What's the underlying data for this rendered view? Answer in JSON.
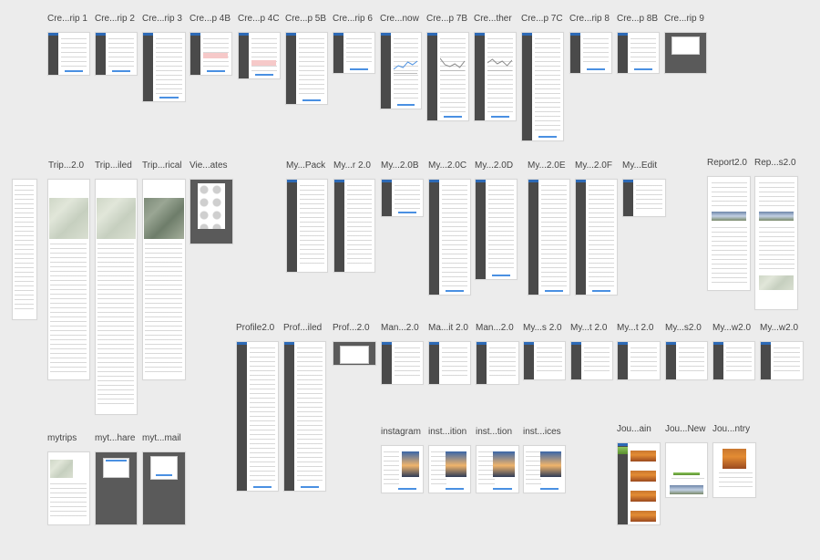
{
  "board": {
    "artboards": [
      {
        "id": "a1",
        "label": "Cre...rip 1"
      },
      {
        "id": "a2",
        "label": "Cre...rip 2"
      },
      {
        "id": "a3",
        "label": "Cre...rip 3"
      },
      {
        "id": "a4",
        "label": "Cre...p 4B"
      },
      {
        "id": "a5",
        "label": "Cre...p 4C"
      },
      {
        "id": "a6",
        "label": "Cre...p 5B"
      },
      {
        "id": "a7",
        "label": "Cre...rip 6"
      },
      {
        "id": "a8",
        "label": "Cre...now"
      },
      {
        "id": "a9",
        "label": "Cre...p 7B"
      },
      {
        "id": "a10",
        "label": "Cre...ther"
      },
      {
        "id": "a11",
        "label": "Cre...p 7C"
      },
      {
        "id": "a12",
        "label": "Cre...rip 8"
      },
      {
        "id": "a13",
        "label": "Cre...p 8B"
      },
      {
        "id": "a14",
        "label": "Cre...rip 9"
      },
      {
        "id": "b1",
        "label": "Trip...2.0"
      },
      {
        "id": "b2",
        "label": "Trip...iled"
      },
      {
        "id": "b3",
        "label": "Trip...rical"
      },
      {
        "id": "b4",
        "label": "Vie...ates"
      },
      {
        "id": "c1",
        "label": "My...Pack"
      },
      {
        "id": "c2",
        "label": "My...r 2.0"
      },
      {
        "id": "c3",
        "label": "My...2.0B"
      },
      {
        "id": "c4",
        "label": "My...2.0C"
      },
      {
        "id": "c5",
        "label": "My...2.0D"
      },
      {
        "id": "c6",
        "label": "My...2.0E"
      },
      {
        "id": "c7",
        "label": "My...2.0F"
      },
      {
        "id": "c8",
        "label": "My...Edit"
      },
      {
        "id": "d1",
        "label": "Report2.0"
      },
      {
        "id": "d2",
        "label": "Rep...s2.0"
      },
      {
        "id": "e1",
        "label": "Profile2.0"
      },
      {
        "id": "e2",
        "label": "Prof...iled"
      },
      {
        "id": "e3",
        "label": "Prof...2.0"
      },
      {
        "id": "e4",
        "label": "Man...2.0"
      },
      {
        "id": "e5",
        "label": "Ma...it 2.0"
      },
      {
        "id": "e6",
        "label": "Man...2.0"
      },
      {
        "id": "e7",
        "label": "My...s 2.0"
      },
      {
        "id": "e8",
        "label": "My...t 2.0"
      },
      {
        "id": "e9",
        "label": "My...t 2.0"
      },
      {
        "id": "e10",
        "label": "My...s2.0"
      },
      {
        "id": "e11",
        "label": "My...w2.0"
      },
      {
        "id": "e12",
        "label": "My...w2.0"
      },
      {
        "id": "f1",
        "label": "instagram"
      },
      {
        "id": "f2",
        "label": "inst...ition"
      },
      {
        "id": "f3",
        "label": "inst...tion"
      },
      {
        "id": "f4",
        "label": "inst...ices"
      },
      {
        "id": "g1",
        "label": "Jou...ain"
      },
      {
        "id": "g2",
        "label": "Jou...New"
      },
      {
        "id": "g3",
        "label": "Jou...ntry"
      },
      {
        "id": "h1",
        "label": "mytrips"
      },
      {
        "id": "h2",
        "label": "myt...hare"
      },
      {
        "id": "h3",
        "label": "myt...mail"
      }
    ]
  }
}
